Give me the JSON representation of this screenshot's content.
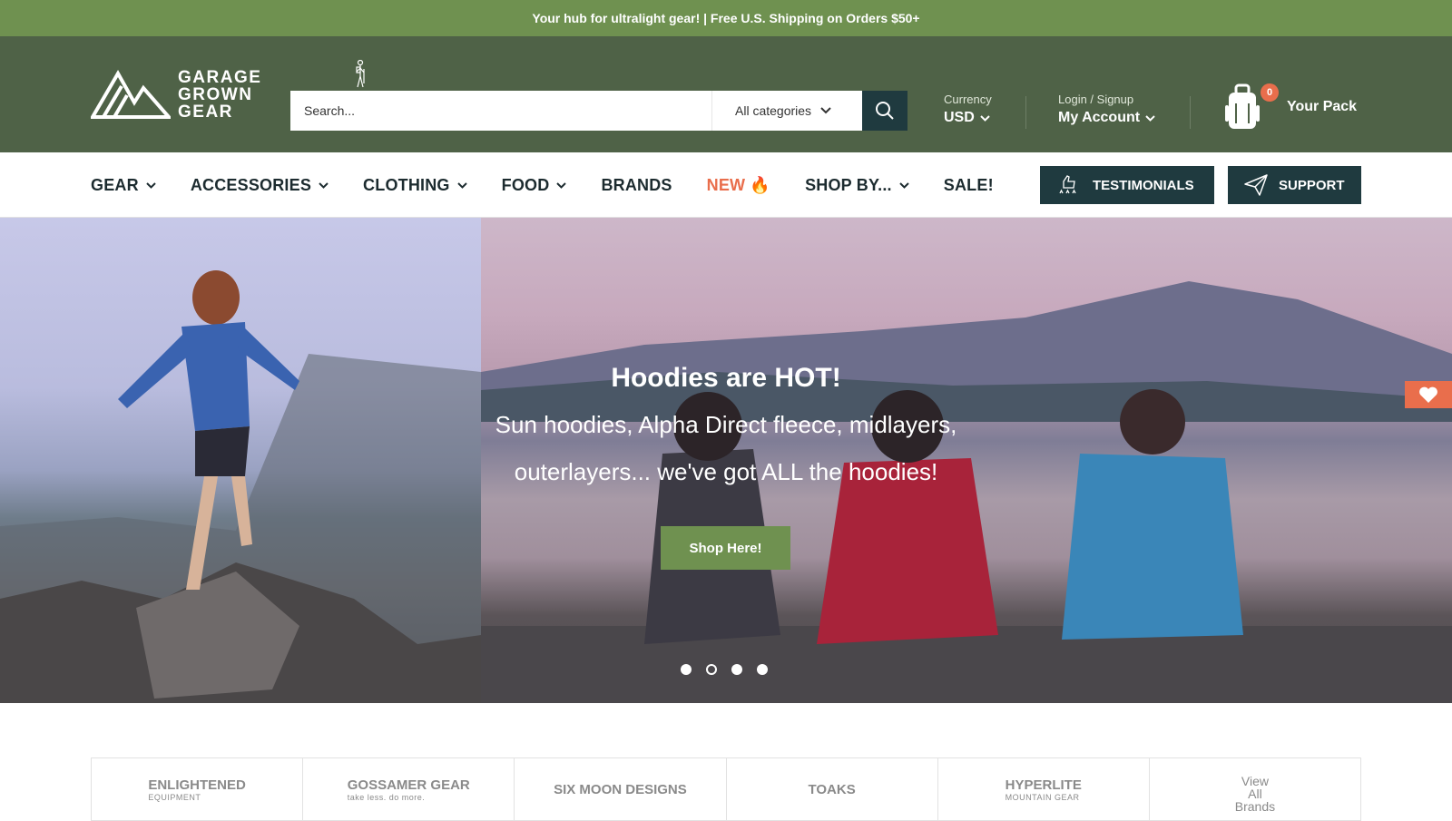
{
  "announcement": "Your hub for ultralight gear! | Free U.S. Shipping on Orders $50+",
  "logo": {
    "line1": "GARAGE",
    "line2": "GROWN",
    "line3": "GEAR"
  },
  "search": {
    "placeholder": "Search...",
    "category": "All categories"
  },
  "currency": {
    "label": "Currency",
    "value": "USD"
  },
  "account": {
    "label": "Login / Signup",
    "value": "My Account"
  },
  "cart": {
    "count": "0",
    "label": "Your Pack"
  },
  "nav": {
    "items": [
      {
        "label": "GEAR",
        "dropdown": true
      },
      {
        "label": "ACCESSORIES",
        "dropdown": true
      },
      {
        "label": "CLOTHING",
        "dropdown": true
      },
      {
        "label": "FOOD",
        "dropdown": true
      },
      {
        "label": "BRANDS",
        "dropdown": false
      },
      {
        "label": "NEW 🔥",
        "dropdown": false
      },
      {
        "label": "SHOP BY...",
        "dropdown": true
      },
      {
        "label": "SALE!",
        "dropdown": false
      }
    ],
    "testimonials": "TESTIMONIALS",
    "support": "SUPPORT"
  },
  "hero": {
    "title": "Hoodies are HOT!",
    "subtitle": "Sun hoodies, Alpha Direct fleece, midlayers, outerlayers... we've got ALL the hoodies!",
    "button": "Shop Here!",
    "slide_count": 4,
    "active_slide": 2
  },
  "brands": [
    {
      "name": "ENLIGHTENED",
      "tagline": "EQUIPMENT"
    },
    {
      "name": "GOSSAMER GEAR",
      "tagline": "take less. do more."
    },
    {
      "name": "SIX MOON DESIGNS",
      "tagline": ""
    },
    {
      "name": "TOAKS",
      "tagline": ""
    },
    {
      "name": "HYPERLITE",
      "tagline": "MOUNTAIN GEAR"
    },
    {
      "name": "View All Brands",
      "tagline": ""
    }
  ],
  "colors": {
    "announce_bg": "#6f9150",
    "header_bg": "#4f6247",
    "dark_button": "#1f3a3f",
    "accent_orange": "#e96e4c"
  }
}
